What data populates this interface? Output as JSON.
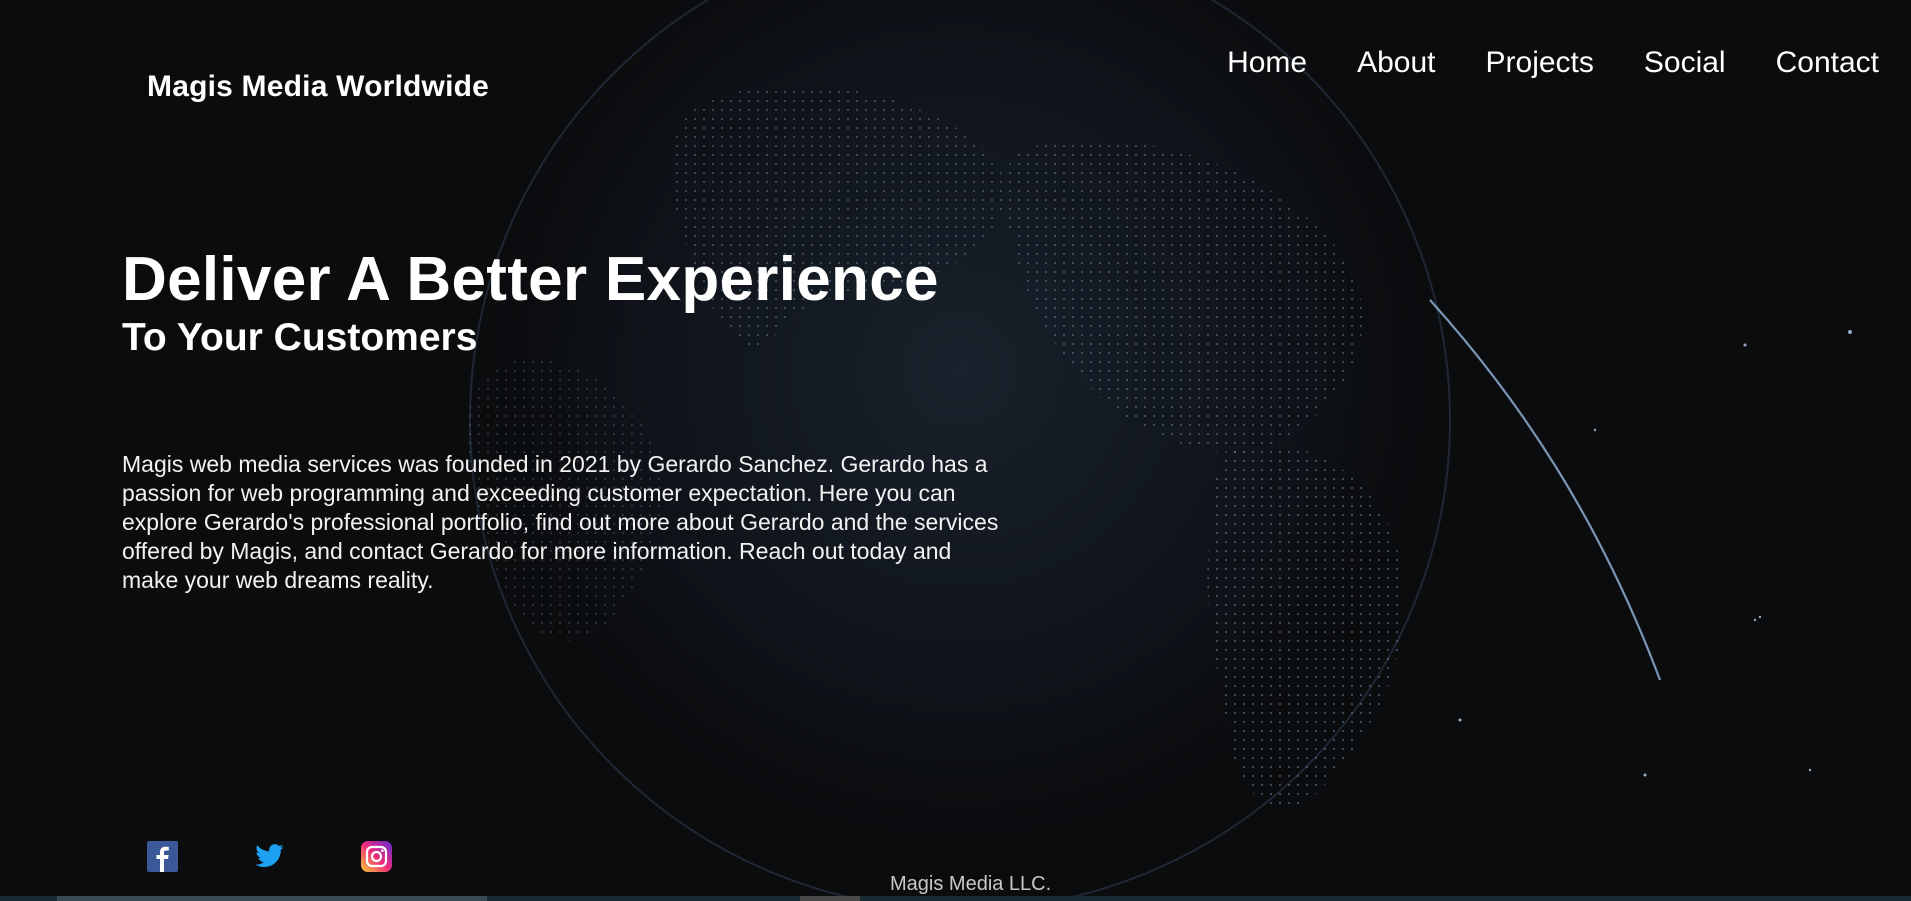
{
  "header": {
    "brand": "Magis Media Worldwide"
  },
  "nav": {
    "items": [
      "Home",
      "About",
      "Projects",
      "Social",
      "Contact"
    ]
  },
  "hero": {
    "title": "Deliver A Better Experience",
    "subtitle": "To Your Customers",
    "description": "Magis web media services was founded in 2021 by Gerardo Sanchez. Gerardo has a passion for web programming and exceeding customer expectation. Here you can explore Gerardo's professional portfolio, find out more about Gerardo and the services offered by Magis, and contact Gerardo for more information. Reach out today and make your web dreams reality."
  },
  "social": {
    "icons": [
      "facebook-icon",
      "twitter-icon",
      "instagram-icon"
    ]
  },
  "footer": {
    "text": "Magis Media LLC."
  },
  "colors": {
    "background": "#0b0c0e",
    "globe_dots": "#8fb6e0",
    "text": "#ffffff"
  }
}
